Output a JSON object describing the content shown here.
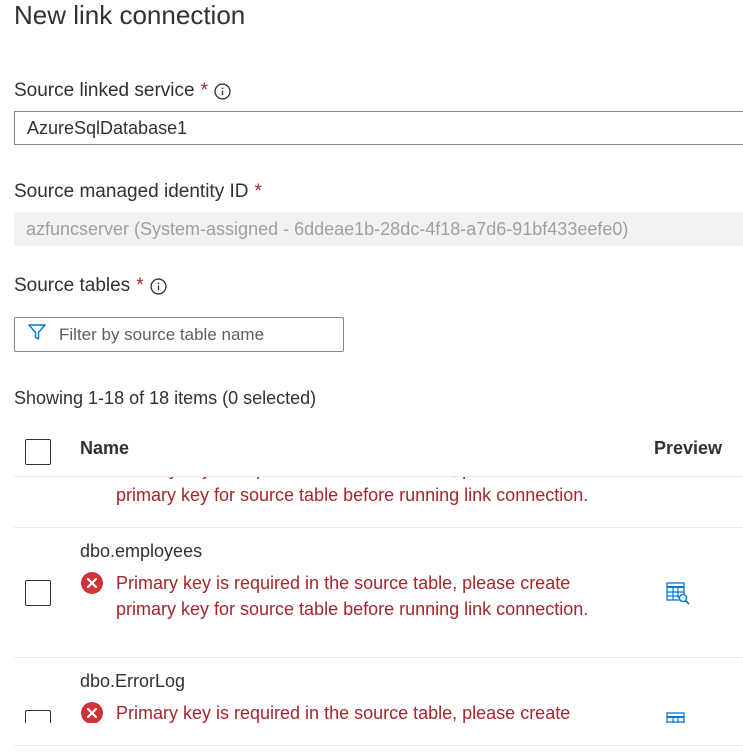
{
  "title": "New link connection",
  "source_linked_service": {
    "label": "Source linked service",
    "required": "*",
    "value": "AzureSqlDatabase1"
  },
  "source_identity": {
    "label": "Source managed identity ID",
    "required": "*",
    "value": "azfuncserver (System-assigned - 6ddeae1b-28dc-4f18-a7d6-91bf433eefe0)"
  },
  "source_tables": {
    "label": "Source tables",
    "required": "*",
    "filter_placeholder": "Filter by source table name",
    "showing": "Showing 1-18 of 18 items (0 selected)",
    "columns": {
      "name": "Name",
      "preview": "Preview"
    },
    "rows": [
      {
        "name": "",
        "error": "Primary key is required in the source table, please create primary key for source table before running link connection."
      },
      {
        "name": "dbo.employees",
        "error": "Primary key is required in the source table, please create primary key for source table before running link connection."
      },
      {
        "name": "dbo.ErrorLog",
        "error": "Primary key is required in the source table, please create primary key for source table before running link connection."
      }
    ]
  },
  "colors": {
    "error": "#a4262c",
    "accent": "#0078d4",
    "readonly_bg": "#f3f2f1"
  },
  "icons": [
    "info-icon",
    "filter-icon",
    "error-icon",
    "table-preview-icon"
  ]
}
